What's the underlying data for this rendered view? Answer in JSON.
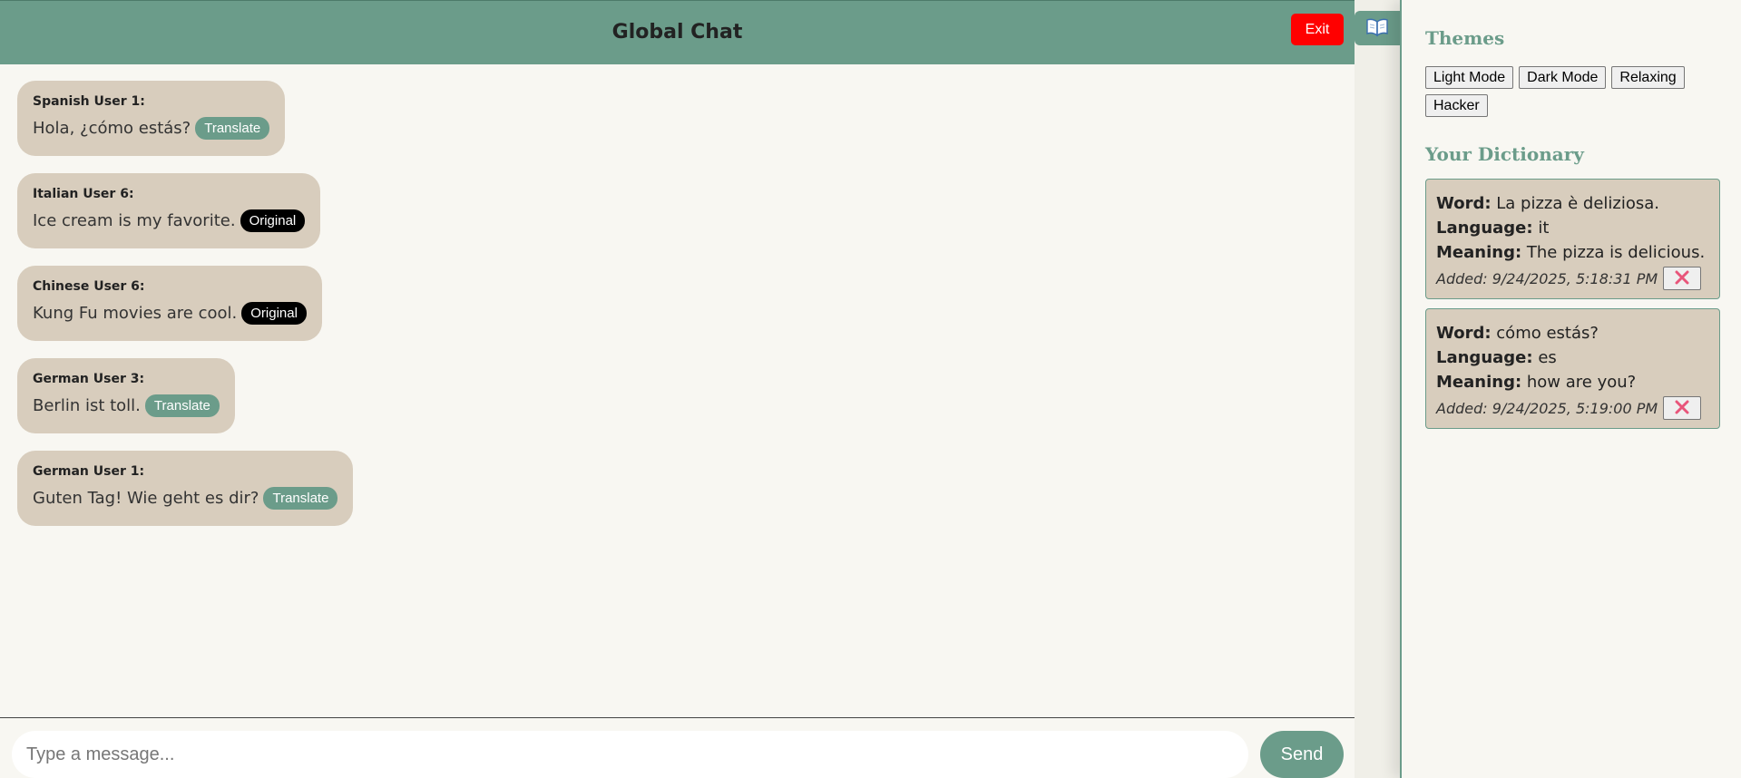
{
  "header": {
    "title": "Global Chat",
    "exit_label": "Exit"
  },
  "messages": [
    {
      "sender": "Spanish User 1:",
      "text": "Hola, ¿cómo estás?",
      "action": "Translate"
    },
    {
      "sender": "Italian User 6:",
      "text": "Ice cream is my favorite.",
      "action": "Original"
    },
    {
      "sender": "Chinese User 6:",
      "text": "Kung Fu movies are cool.",
      "action": "Original"
    },
    {
      "sender": "German User 3:",
      "text": "Berlin ist toll.",
      "action": "Translate"
    },
    {
      "sender": "German User 1:",
      "text": "Guten Tag! Wie geht es dir?",
      "action": "Translate"
    }
  ],
  "composer": {
    "placeholder": "Type a message...",
    "value": "",
    "send_label": "Send"
  },
  "toggle": {
    "icon": "open-book-icon"
  },
  "panel": {
    "themes_title": "Themes",
    "themes": [
      "Light Mode",
      "Dark Mode",
      "Relaxing",
      "Hacker"
    ],
    "dictionary_title": "Your Dictionary",
    "labels": {
      "word": "Word:",
      "language": "Language:",
      "meaning": "Meaning:"
    },
    "entries": [
      {
        "word": "La pizza è deliziosa.",
        "language": "it",
        "meaning": "The pizza is delicious.",
        "added": "Added: 9/24/2025, 5:18:31 PM"
      },
      {
        "word": "cómo estás?",
        "language": "es",
        "meaning": "how are you?",
        "added": "Added: 9/24/2025, 5:19:00 PM"
      }
    ],
    "delete_icon": "close-icon"
  },
  "colors": {
    "accent": "#6b9c8a",
    "bubble": "#d8cdbd",
    "background": "#f8f7f2",
    "exit": "#ff0000",
    "original_pill": "#000000",
    "delete_x": "#e8557a"
  }
}
